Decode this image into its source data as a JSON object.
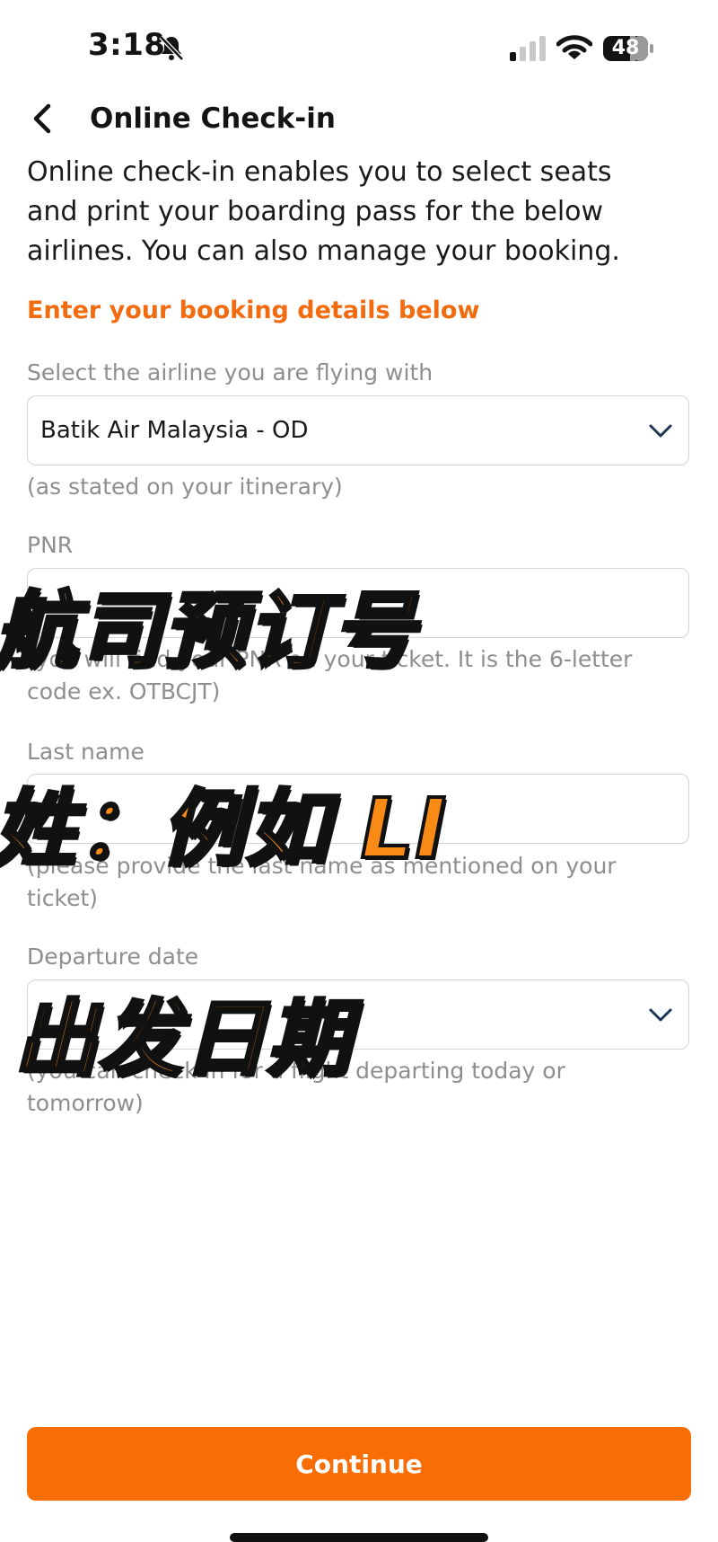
{
  "status_bar": {
    "time": "3:18",
    "battery": "48"
  },
  "header": {
    "title": "Online Check-in"
  },
  "intro": "Online check-in enables you to select seats and print your boarding pass for the below airlines. You can also manage your booking.",
  "section_heading": "Enter your booking details below",
  "airline": {
    "label": "Select the airline you are flying with",
    "value": "Batik Air Malaysia - OD",
    "hint": "(as stated on your itinerary)"
  },
  "pnr": {
    "label": "PNR",
    "value": "",
    "hint": "(you will find your PNR on your ticket. It is the 6-letter code ex. OTBCJT)"
  },
  "last_name": {
    "label": "Last name",
    "value": "",
    "hint": "(please provide the last name as mentioned on your ticket)"
  },
  "departure": {
    "label": "Departure date",
    "value": "",
    "hint": "(you can check in for a flight departing today or tomorrow)"
  },
  "overlays": {
    "pnr": "航司预订号",
    "last_name": "姓：例如  LI",
    "departure": "出发日期"
  },
  "continue_label": "Continue",
  "colors": {
    "accent": "#f96d06",
    "heading": "#f26b0f",
    "overlay_fill": "#f98a16"
  }
}
